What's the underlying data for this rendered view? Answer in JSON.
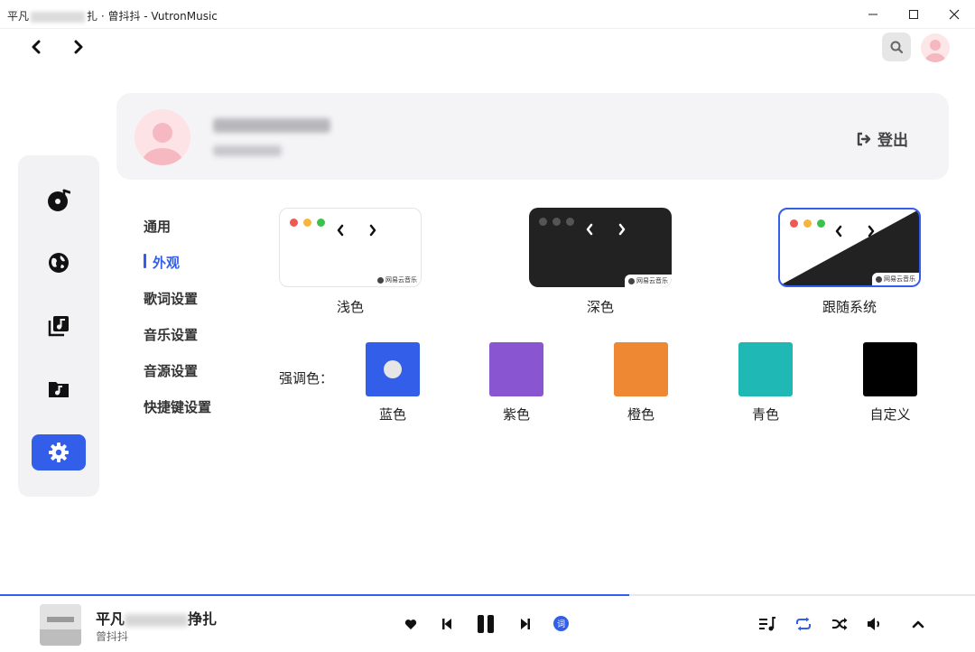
{
  "window": {
    "title_prefix": "平凡",
    "title_suffix": "扎 · 曾抖抖 - VutronMusic"
  },
  "profile": {
    "logout_label": "登出"
  },
  "sidebar": {
    "items": [
      {
        "icon": "music-disc-icon"
      },
      {
        "icon": "globe-icon"
      },
      {
        "icon": "music-library-icon"
      },
      {
        "icon": "music-folder-icon"
      },
      {
        "icon": "gear-icon",
        "active": true
      }
    ]
  },
  "settings_nav": {
    "items": [
      {
        "label": "通用"
      },
      {
        "label": "外观",
        "active": true
      },
      {
        "label": "歌词设置"
      },
      {
        "label": "音乐设置"
      },
      {
        "label": "音源设置"
      },
      {
        "label": "快捷键设置"
      }
    ]
  },
  "appearance": {
    "themes": [
      {
        "label": "浅色",
        "selected": false
      },
      {
        "label": "深色",
        "selected": false
      },
      {
        "label": "跟随系统",
        "selected": true
      }
    ],
    "watermark": "网易云音乐",
    "accent_label": "强调色：",
    "accents": [
      {
        "label": "蓝色",
        "color": "#335eea",
        "selected": true
      },
      {
        "label": "紫色",
        "color": "#8a55d1"
      },
      {
        "label": "橙色",
        "color": "#ee8833"
      },
      {
        "label": "青色",
        "color": "#1fb8b4"
      },
      {
        "label": "自定义",
        "color": "#000000"
      }
    ]
  },
  "player": {
    "title_prefix": "平凡",
    "title_suffix": "挣扎",
    "artist": "曾抖抖",
    "progress": 0.645,
    "lyric_label": "词"
  }
}
